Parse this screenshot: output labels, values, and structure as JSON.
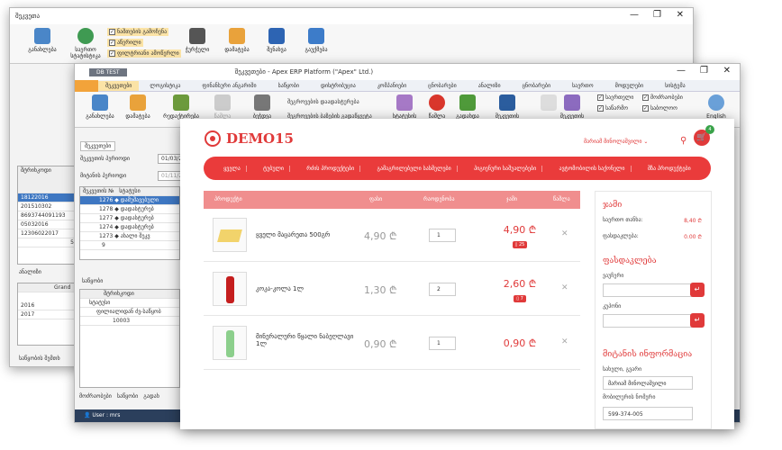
{
  "back_window": {
    "title": "შეკვეთა",
    "btn1": "განახლება",
    "btn2": "საერთო სტატისტიკა",
    "chk1": "ნაშთების გამოჩენა",
    "chk2": "აწერილი",
    "chk3": "ფილტრიანი ამოწერლი",
    "btn3": "ჭურჭელი",
    "btn4": "დამატება",
    "btn5": "შენახვა",
    "btn6": "გაუქმება"
  },
  "mid_window": {
    "title": "შეკვეთები - Apex ERP Platform (\"Apex\" Ltd.)",
    "tag": "DB TEST",
    "menu": [
      "შეკვეთები",
      "ლოგისტიკა",
      "ფინანსური ანგარიში",
      "საწყობი",
      "დისტრიბუცია",
      "კომპანიები",
      "ცნობარები",
      "ანალიზი",
      "ცნობარები",
      "საერთო",
      "მოდულები",
      "სისტემა"
    ],
    "ribbon": [
      "განახლება",
      "დამატება",
      "რედაქტირება",
      "წაშლა",
      "ბეჭდვა",
      "შეგროვების დაადასტურება",
      "შეგროვების ბაზების გადაწყვეტა",
      "სტატუსის გაუქმება",
      "წაშლა",
      "გადახდა",
      "შეკვეთის ოპერაცია",
      "შეკვეთის"
    ],
    "chk": [
      "საერთელი",
      "საწარმო",
      "მოძრაობები",
      "საბოლოო"
    ],
    "eng": "English",
    "tab": "შეკვეთები",
    "lbl_from": "შეკვეთის პერიოდი",
    "lbl_to": "მიტანის პერიოდი",
    "date1": "01/03/2016",
    "date2": "01/11/2016",
    "col_no": "შეკვეთის №",
    "col_status": "სტატუსი",
    "col_code": "შტრიხკოდი",
    "rows": [
      {
        "no": "1276",
        "s": "დამუშავებული"
      },
      {
        "no": "1278",
        "s": "დადასტურებ"
      },
      {
        "no": "1277",
        "s": "დადასტურებ"
      },
      {
        "no": "1274",
        "s": "დადასტურებ"
      },
      {
        "no": "1273",
        "s": "ახალი შეკვ"
      }
    ],
    "count": "9",
    "left_codes": [
      "18122016",
      "201510302",
      "8693744091193",
      "05032016",
      "12306022017"
    ],
    "left_count": "5",
    "years": [
      "2016",
      "2017"
    ],
    "footer": "საწყობის შემთხ",
    "user": "User : mrs",
    "bottom_tabs": [
      "მოძრაობები",
      "საწყობი",
      "გადახ"
    ],
    "sub_col": "შტრიხკოდი",
    "sub_row": "10003",
    "sub_group": "ფილიალიდან ძვ-საწყობ",
    "sub_title": "საწყობი",
    "grand": "Grand",
    "analytics": "ანალიზი"
  },
  "shop": {
    "logo": "DEMO15",
    "user": "მარიამ მინოლაშვილი",
    "cart_count": "4",
    "nav": [
      "ყველა",
      "ტუბული",
      "რძის პროდუქტები",
      "გამაგრილებელი სასმელები",
      "პიგიენური საშუალებები",
      "ავტომობილის საქონელი",
      "შზა პროდუქტები"
    ],
    "cols": {
      "product": "პროდუქტი",
      "price": "ფასი",
      "qty": "რაოდენობა",
      "sum": "ჯამი",
      "del": "წაშლა"
    },
    "items": [
      {
        "name": "ყველი მაცარეთა 500გრ",
        "price": "4,90 ₾",
        "qty": "1",
        "sum": "4,90 ₾",
        "badge": "25"
      },
      {
        "name": "კოკა-კოლა 1ლ",
        "price": "1,30 ₾",
        "qty": "2",
        "sum": "2,60 ₾",
        "badge": "7"
      },
      {
        "name": "მინერალური წყალი ნაბეღლავი 1ლ",
        "price": "0,90 ₾",
        "qty": "1",
        "sum": "0,90 ₾",
        "badge": ""
      }
    ],
    "side": {
      "h1": "ჯამი",
      "total_lbl": "საერთო თანხა:",
      "total": "8,40 ₾",
      "disc_lbl": "ფასდაკლება:",
      "disc": "0.00 ₾",
      "h2": "ფასდაკლება",
      "voucher": "ვაუჩერი",
      "coupon": "კუპონი",
      "h3": "მიტანის ინფორმაცია",
      "name_lbl": "სახელი, გვარი",
      "name": "მარიამ მინოლაშვილი",
      "phone_lbl": "მობილურის ნომერი",
      "phone": "599-374-005"
    }
  }
}
